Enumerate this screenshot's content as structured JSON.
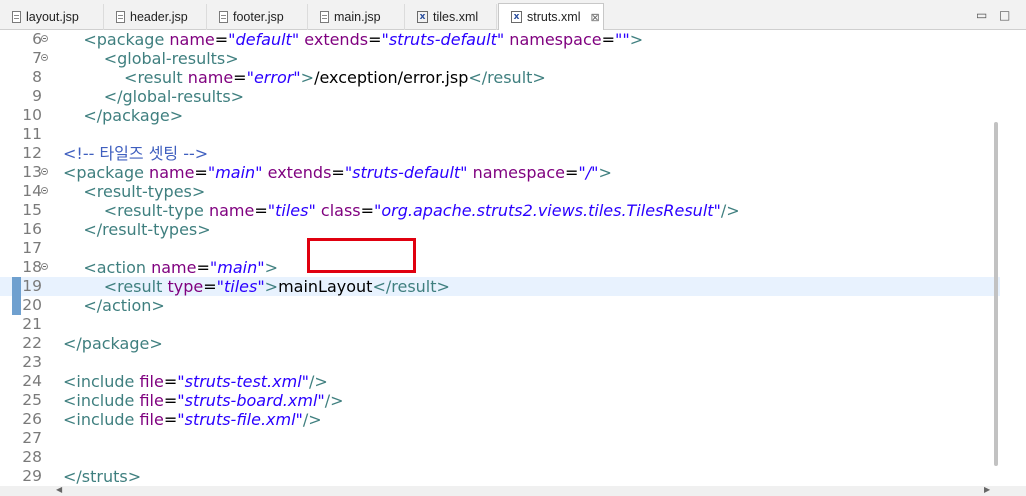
{
  "tabs": [
    {
      "label": "layout.jsp",
      "icon": "jsp-file-icon"
    },
    {
      "label": "header.jsp",
      "icon": "jsp-file-icon"
    },
    {
      "label": "footer.jsp",
      "icon": "jsp-file-icon"
    },
    {
      "label": "main.jsp",
      "icon": "jsp-file-icon"
    },
    {
      "label": "tiles.xml",
      "icon": "xml-file-icon"
    },
    {
      "label": "struts.xml",
      "icon": "xml-file-icon",
      "active": true,
      "close": "⊠"
    }
  ],
  "window_controls": {
    "minimize": "▭",
    "maximize": "□"
  },
  "colors": {
    "tag": "#3f7f7f",
    "attribute": "#7f007f",
    "value": "#2a00ff",
    "comment": "#3f5fbf",
    "current_line": "#e8f2fe",
    "highlight_box": "#e0000f"
  },
  "editor": {
    "highlighted_text": "mainLayout",
    "lines": [
      {
        "n": "6",
        "fold": true,
        "tokens": [
          [
            "x",
            "    "
          ],
          [
            "t",
            "<package "
          ],
          [
            "a",
            "name"
          ],
          [
            "x",
            "="
          ],
          [
            "v",
            "\"default\""
          ],
          [
            "x",
            " "
          ],
          [
            "a",
            "extends"
          ],
          [
            "x",
            "="
          ],
          [
            "v",
            "\"struts-default\""
          ],
          [
            "x",
            " "
          ],
          [
            "a",
            "namespace"
          ],
          [
            "x",
            "="
          ],
          [
            "v",
            "\"\""
          ],
          [
            "t",
            ">"
          ]
        ]
      },
      {
        "n": "7",
        "fold": true,
        "tokens": [
          [
            "x",
            "        "
          ],
          [
            "t",
            "<global-results>"
          ]
        ]
      },
      {
        "n": "8",
        "tokens": [
          [
            "x",
            "            "
          ],
          [
            "t",
            "<result "
          ],
          [
            "a",
            "name"
          ],
          [
            "x",
            "="
          ],
          [
            "v",
            "\"error\""
          ],
          [
            "t",
            ">"
          ],
          [
            "x",
            "/exception/error.jsp"
          ],
          [
            "t",
            "</result>"
          ]
        ]
      },
      {
        "n": "9",
        "tokens": [
          [
            "x",
            "        "
          ],
          [
            "t",
            "</global-results>"
          ]
        ]
      },
      {
        "n": "10",
        "tokens": [
          [
            "x",
            "    "
          ],
          [
            "t",
            "</package>"
          ]
        ]
      },
      {
        "n": "11",
        "tokens": []
      },
      {
        "n": "12",
        "tokens": [
          [
            "c",
            "<!-- 타일즈 셋팅 -->"
          ]
        ]
      },
      {
        "n": "13",
        "fold": true,
        "tokens": [
          [
            "t",
            "<package "
          ],
          [
            "a",
            "name"
          ],
          [
            "x",
            "="
          ],
          [
            "v",
            "\"main\""
          ],
          [
            "x",
            " "
          ],
          [
            "a",
            "extends"
          ],
          [
            "x",
            "="
          ],
          [
            "v",
            "\"struts-default\""
          ],
          [
            "x",
            " "
          ],
          [
            "a",
            "namespace"
          ],
          [
            "x",
            "="
          ],
          [
            "v",
            "\"/\""
          ],
          [
            "t",
            ">"
          ]
        ]
      },
      {
        "n": "14",
        "fold": true,
        "tokens": [
          [
            "x",
            "    "
          ],
          [
            "t",
            "<result-types>"
          ]
        ]
      },
      {
        "n": "15",
        "tokens": [
          [
            "x",
            "        "
          ],
          [
            "t",
            "<result-type "
          ],
          [
            "a",
            "name"
          ],
          [
            "x",
            "="
          ],
          [
            "v",
            "\"tiles\""
          ],
          [
            "x",
            " "
          ],
          [
            "a",
            "class"
          ],
          [
            "x",
            "="
          ],
          [
            "v",
            "\"org.apache.struts2.views.tiles.TilesResult\""
          ],
          [
            "t",
            "/>"
          ]
        ]
      },
      {
        "n": "16",
        "tokens": [
          [
            "x",
            "    "
          ],
          [
            "t",
            "</result-types>"
          ]
        ]
      },
      {
        "n": "17",
        "tokens": []
      },
      {
        "n": "18",
        "fold": true,
        "tokens": [
          [
            "x",
            "    "
          ],
          [
            "t",
            "<action "
          ],
          [
            "a",
            "name"
          ],
          [
            "x",
            "="
          ],
          [
            "v",
            "\"main\""
          ],
          [
            "t",
            ">"
          ]
        ]
      },
      {
        "n": "19",
        "current": true,
        "changed": true,
        "tokens": [
          [
            "x",
            "        "
          ],
          [
            "t",
            "<result "
          ],
          [
            "a",
            "type"
          ],
          [
            "x",
            "="
          ],
          [
            "v",
            "\"tiles\""
          ],
          [
            "t",
            ">"
          ],
          [
            "x",
            "mainLayout"
          ],
          [
            "t",
            "</result>"
          ]
        ]
      },
      {
        "n": "20",
        "changed": true,
        "tokens": [
          [
            "x",
            "    "
          ],
          [
            "t",
            "</action>"
          ]
        ]
      },
      {
        "n": "21",
        "tokens": []
      },
      {
        "n": "22",
        "tokens": [
          [
            "t",
            "</package>"
          ]
        ]
      },
      {
        "n": "23",
        "tokens": []
      },
      {
        "n": "24",
        "tokens": [
          [
            "t",
            "<include "
          ],
          [
            "a",
            "file"
          ],
          [
            "x",
            "="
          ],
          [
            "v",
            "\"struts-test.xml\""
          ],
          [
            "t",
            "/>"
          ]
        ]
      },
      {
        "n": "25",
        "tokens": [
          [
            "t",
            "<include "
          ],
          [
            "a",
            "file"
          ],
          [
            "x",
            "="
          ],
          [
            "v",
            "\"struts-board.xml\""
          ],
          [
            "t",
            "/>"
          ]
        ]
      },
      {
        "n": "26",
        "tokens": [
          [
            "t",
            "<include "
          ],
          [
            "a",
            "file"
          ],
          [
            "x",
            "="
          ],
          [
            "v",
            "\"struts-file.xml\""
          ],
          [
            "t",
            "/>"
          ]
        ]
      },
      {
        "n": "27",
        "tokens": []
      },
      {
        "n": "28",
        "tokens": []
      },
      {
        "n": "29",
        "tokens": [
          [
            "t",
            "</struts>"
          ]
        ]
      }
    ]
  },
  "scrollbar": {
    "left_arrow": "◀",
    "right_arrow": "▶"
  }
}
